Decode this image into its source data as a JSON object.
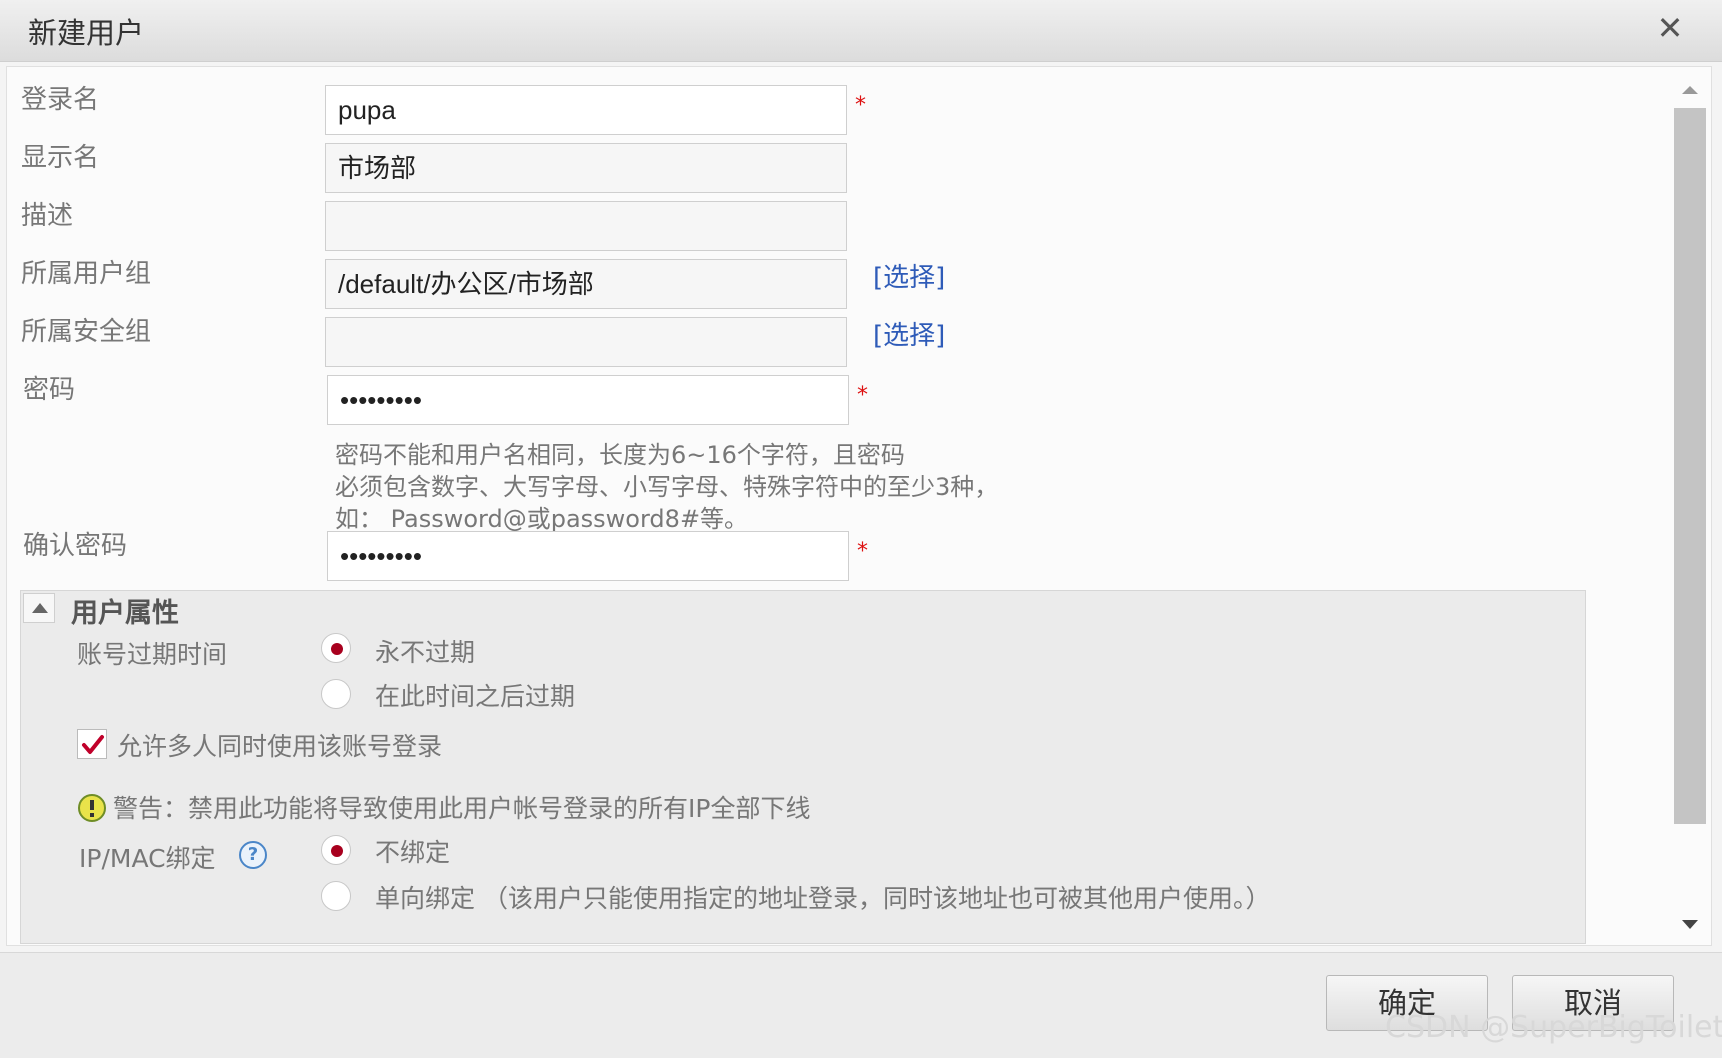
{
  "window": {
    "title": "新建用户",
    "close_symbol": "✕"
  },
  "form": {
    "login_name": {
      "label": "登录名",
      "value": "pupa",
      "required": "*"
    },
    "display_name": {
      "label": "显示名",
      "value": "市场部"
    },
    "description": {
      "label": "描述",
      "value": ""
    },
    "user_group": {
      "label": "所属用户组",
      "value": "/default/办公区/市场部",
      "select_link": "[选择]"
    },
    "security_group": {
      "label": "所属安全组",
      "value": "",
      "select_link": "[选择]"
    },
    "password": {
      "label": "密码",
      "value": "•••••••••",
      "required": "*",
      "hint_line1": "密码不能和用户名相同，长度为6~16个字符，且密码",
      "hint_line2": "必须包含数字、大写字母、小写字母、特殊字符中的至少3种，",
      "hint_line3": "如： Password@或password8#等。"
    },
    "confirm_password": {
      "label": "确认密码",
      "value": "•••••••••",
      "required": "*"
    }
  },
  "user_properties": {
    "title": "用户属性",
    "expiry": {
      "label": "账号过期时间",
      "options": [
        "永不过期",
        "在此时间之后过期"
      ],
      "selected": "永不过期"
    },
    "multi_login": {
      "label": "允许多人同时使用该账号登录",
      "checked": true
    },
    "warning": "警告：禁用此功能将导致使用此用户帐号登录的所有IP全部下线",
    "ip_mac_binding": {
      "label": "IP/MAC绑定",
      "help_symbol": "?",
      "options": [
        "不绑定",
        "单向绑定 （该用户只能使用指定的地址登录，同时该地址也可被其他用户使用。）"
      ],
      "selected": "不绑定"
    }
  },
  "buttons": {
    "ok": "确定",
    "cancel": "取消"
  },
  "watermark": "CSDN @SuperBigToilet",
  "colors": {
    "radio_selected": "#a8001e",
    "link": "#2e5bb8",
    "required": "#dd1111",
    "check": "#c0002a"
  }
}
